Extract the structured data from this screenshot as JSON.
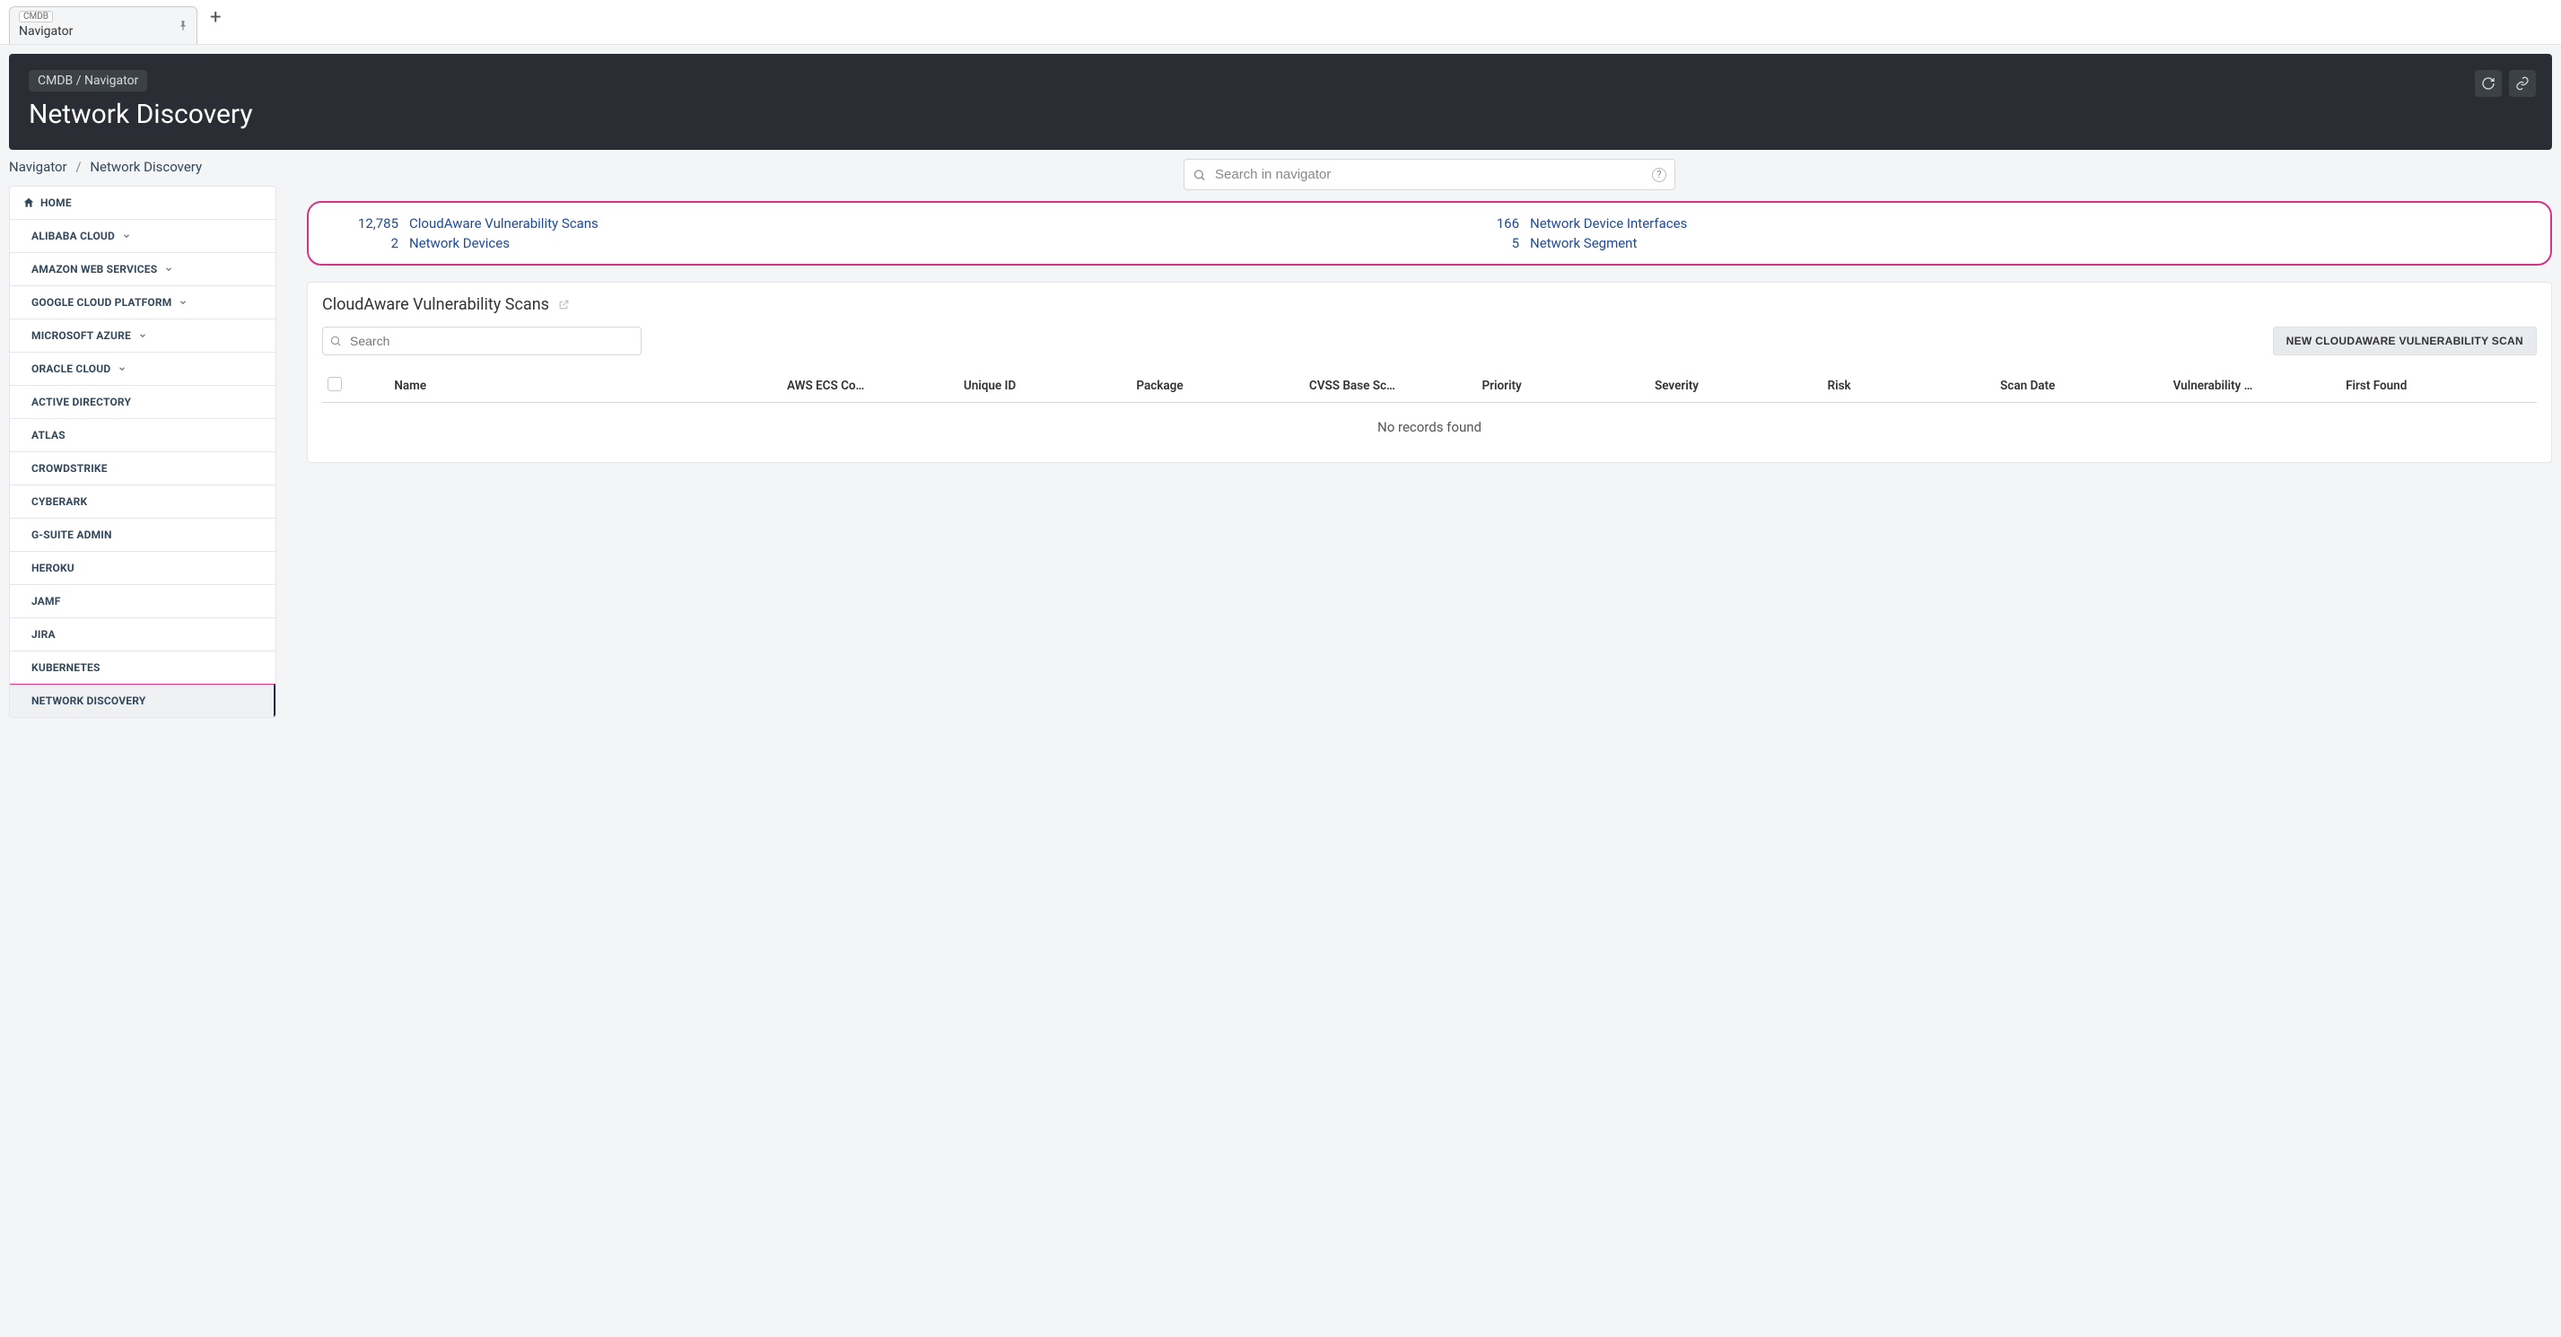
{
  "tab": {
    "badge": "CMDB",
    "title": "Navigator"
  },
  "header": {
    "breadcrumb": "CMDB / Navigator",
    "title": "Network Discovery"
  },
  "sub_breadcrumb": {
    "root": "Navigator",
    "current": "Network Discovery"
  },
  "search": {
    "placeholder": "Search in navigator"
  },
  "sidebar": {
    "home": "HOME",
    "items": [
      {
        "label": "ALIBABA CLOUD",
        "expandable": true
      },
      {
        "label": "AMAZON WEB SERVICES",
        "expandable": true
      },
      {
        "label": "GOOGLE CLOUD PLATFORM",
        "expandable": true
      },
      {
        "label": "MICROSOFT AZURE",
        "expandable": true
      },
      {
        "label": "ORACLE CLOUD",
        "expandable": true
      },
      {
        "label": "ACTIVE DIRECTORY",
        "expandable": false
      },
      {
        "label": "ATLAS",
        "expandable": false
      },
      {
        "label": "CROWDSTRIKE",
        "expandable": false
      },
      {
        "label": "CYBERARK",
        "expandable": false
      },
      {
        "label": "G-SUITE ADMIN",
        "expandable": false
      },
      {
        "label": "HEROKU",
        "expandable": false
      },
      {
        "label": "JAMF",
        "expandable": false
      },
      {
        "label": "JIRA",
        "expandable": false
      },
      {
        "label": "KUBERNETES",
        "expandable": false
      },
      {
        "label": "NETWORK DISCOVERY",
        "expandable": false,
        "active": true
      }
    ]
  },
  "summary": [
    {
      "count": "12,785",
      "label": "CloudAware Vulnerability Scans"
    },
    {
      "count": "166",
      "label": "Network Device Interfaces"
    },
    {
      "count": "2",
      "label": "Network Devices"
    },
    {
      "count": "5",
      "label": "Network Segment"
    }
  ],
  "panel": {
    "title": "CloudAware Vulnerability Scans",
    "search_placeholder": "Search",
    "new_button": "NEW CLOUDAWARE VULNERABILITY SCAN",
    "columns": [
      "Name",
      "AWS ECS Co…",
      "Unique ID",
      "Package",
      "CVSS Base Sc…",
      "Priority",
      "Severity",
      "Risk",
      "Scan Date",
      "Vulnerability …",
      "First Found"
    ],
    "empty": "No records found"
  }
}
